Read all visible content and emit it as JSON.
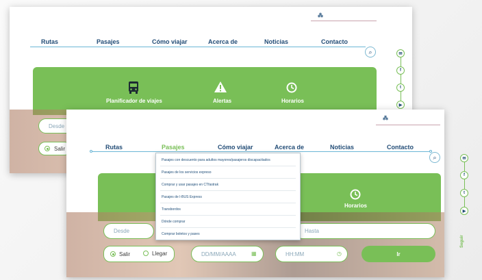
{
  "nav": {
    "items": [
      "Rutas",
      "Pasajes",
      "Cómo viajar",
      "Acerca de",
      "Noticias",
      "Contacto"
    ]
  },
  "lang_icon": "translate-icon",
  "search_icon": "search-icon",
  "panel": {
    "planner": "Planificador de viajes",
    "alerts": "Alertas",
    "schedules": "Horarios"
  },
  "dropdown": {
    "items": [
      "Pasajes con descuento para adultos mayores/pasajeros discapacitados",
      "Pasajes de los servicios expreso",
      "Comprar y usar pasajes en CTfastrak",
      "Pasajes de I-BUS Express",
      "Transbordos",
      "Dónde comprar",
      "Comprar boletos y pases"
    ]
  },
  "form": {
    "from_placeholder": "Desde",
    "to_placeholder": "Hasta",
    "depart": "Salir",
    "arrive": "Llegar",
    "date_placeholder": "DD/MM/AAAA",
    "time_placeholder": "HH:MM",
    "go": "Ir"
  },
  "back_form": {
    "from_placeholder": "Desde",
    "depart": "Salir"
  },
  "social": {
    "follow": "Seguir",
    "icons": [
      "email-icon",
      "facebook-icon",
      "twitter-icon",
      "youtube-icon"
    ]
  },
  "colors": {
    "brand_green": "#79bf57",
    "nav_blue": "#234d77",
    "line_blue": "#6bb6d6"
  }
}
